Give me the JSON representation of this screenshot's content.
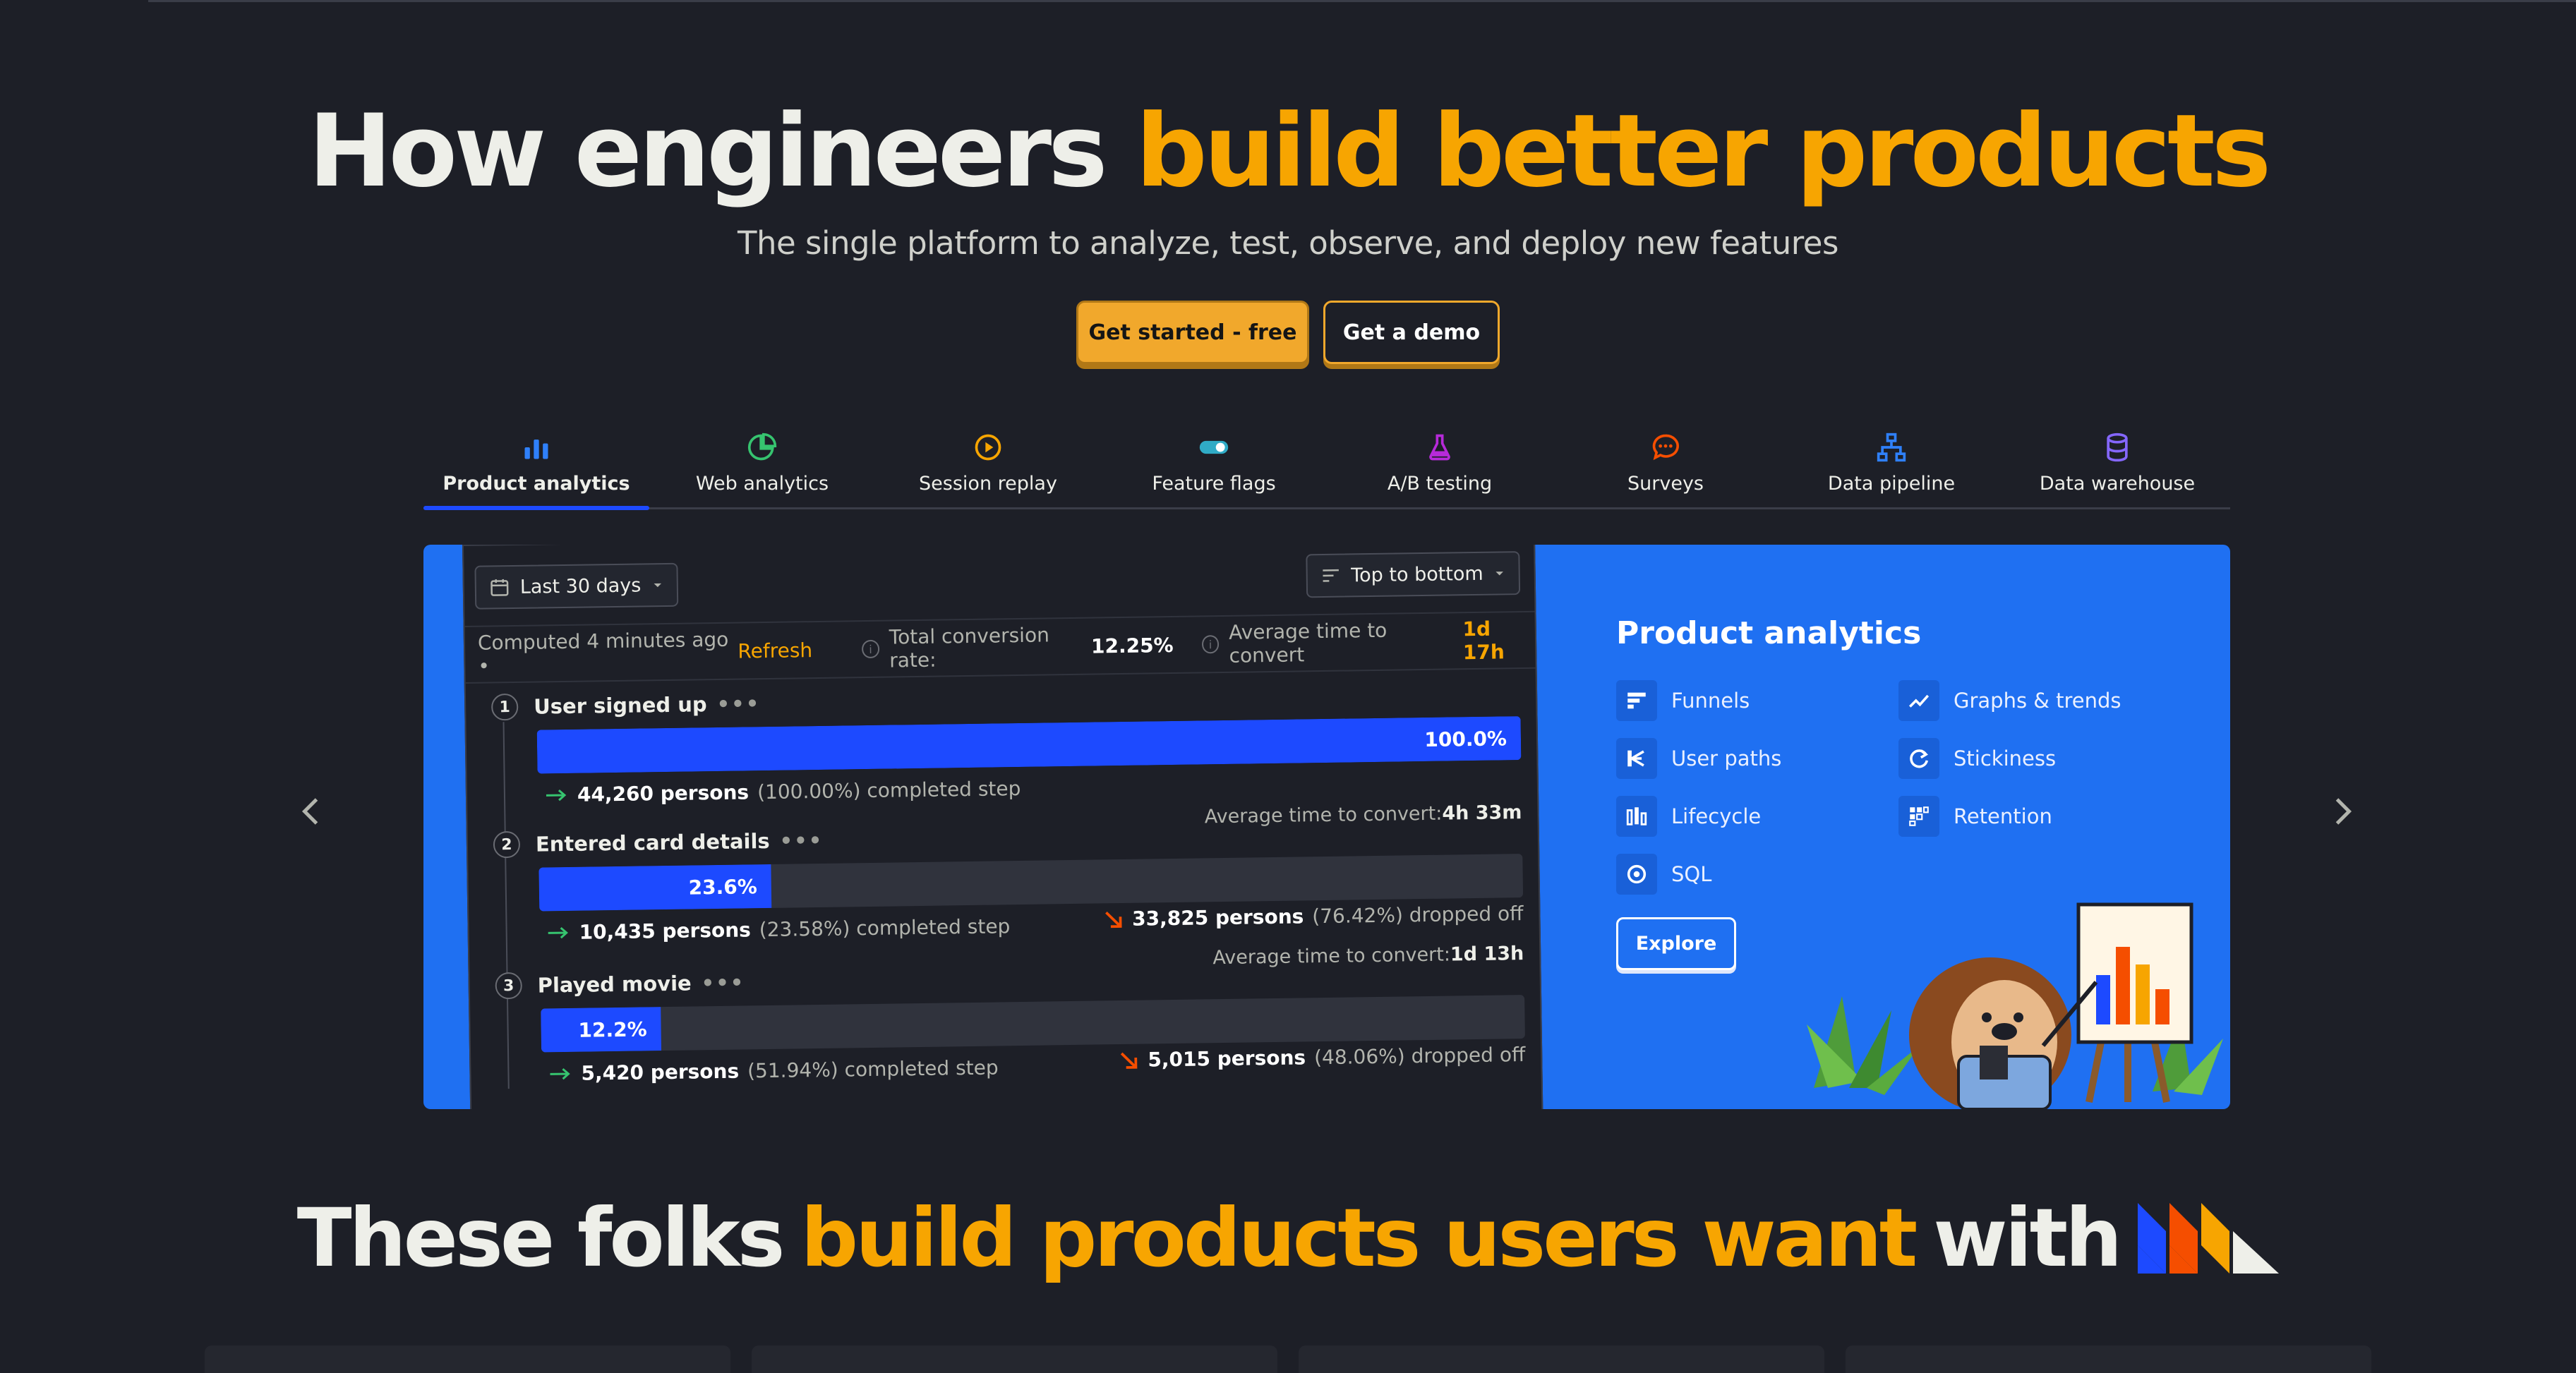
{
  "hero": {
    "title_plain": "How engineers",
    "title_accent": "build better products",
    "subtitle": "The single platform to analyze, test, observe, and deploy new features"
  },
  "cta": {
    "primary": "Get started - free",
    "secondary": "Get a demo"
  },
  "tabs": [
    {
      "label": "Product analytics",
      "icon": "bar-chart-icon",
      "color": "#2f80fa"
    },
    {
      "label": "Web analytics",
      "icon": "pie-chart-icon",
      "color": "#36c46f"
    },
    {
      "label": "Session replay",
      "icon": "replay-icon",
      "color": "#f7a501"
    },
    {
      "label": "Feature flags",
      "icon": "toggle-icon",
      "color": "#30abc6"
    },
    {
      "label": "A/B testing",
      "icon": "flask-icon",
      "color": "#b62ad9"
    },
    {
      "label": "Surveys",
      "icon": "chat-bubble-icon",
      "color": "#f54e00"
    },
    {
      "label": "Data pipeline",
      "icon": "pipeline-icon",
      "color": "#2f80fa"
    },
    {
      "label": "Data warehouse",
      "icon": "database-icon",
      "color": "#8567ff"
    }
  ],
  "funnel": {
    "date_range": "Last 30 days",
    "order": "Top to bottom",
    "computed": "Computed 4 minutes ago •",
    "refresh": "Refresh",
    "total_label": "Total conversion rate:",
    "total_value": "12.25%",
    "avg_label": "Average time to convert",
    "avg_value": "1d 17h",
    "steps": [
      {
        "num": "1",
        "name": "User signed up",
        "percent_label": "100.0%",
        "percent": 100,
        "persons": "44,260 persons",
        "persons_pct": "(100.00%) completed step",
        "avg_label": "",
        "avg_value": "",
        "drop_persons": "",
        "drop_pct": ""
      },
      {
        "num": "2",
        "name": "Entered card details",
        "percent_label": "23.6%",
        "percent": 23.6,
        "persons": "10,435 persons",
        "persons_pct": "(23.58%) completed step",
        "avg_label": "Average time to convert:",
        "avg_value": "4h 33m",
        "drop_persons": "33,825 persons",
        "drop_pct": "(76.42%) dropped off"
      },
      {
        "num": "3",
        "name": "Played movie",
        "percent_label": "12.2%",
        "percent": 12.2,
        "persons": "5,420 persons",
        "persons_pct": "(51.94%) completed step",
        "avg_label": "Average time to convert:",
        "avg_value": "1d 13h",
        "drop_persons": "5,015 persons",
        "drop_pct": "(48.06%) dropped off"
      }
    ]
  },
  "panel": {
    "title": "Product analytics",
    "features": [
      {
        "label": "Funnels",
        "icon": "funnel-icon"
      },
      {
        "label": "Graphs & trends",
        "icon": "trend-line-icon"
      },
      {
        "label": "User paths",
        "icon": "user-paths-icon"
      },
      {
        "label": "Stickiness",
        "icon": "stickiness-icon"
      },
      {
        "label": "Lifecycle",
        "icon": "lifecycle-icon"
      },
      {
        "label": "Retention",
        "icon": "retention-icon"
      },
      {
        "label": "SQL",
        "icon": "sql-icon"
      }
    ],
    "explore": "Explore"
  },
  "bottom": {
    "plain1": "These folks",
    "accent": "build products users want",
    "plain2": "with"
  },
  "colors": {
    "background": "#1d1f27",
    "accent": "#f7a501",
    "blue": "#1d4aff",
    "panel_blue": "#1f70f2"
  }
}
